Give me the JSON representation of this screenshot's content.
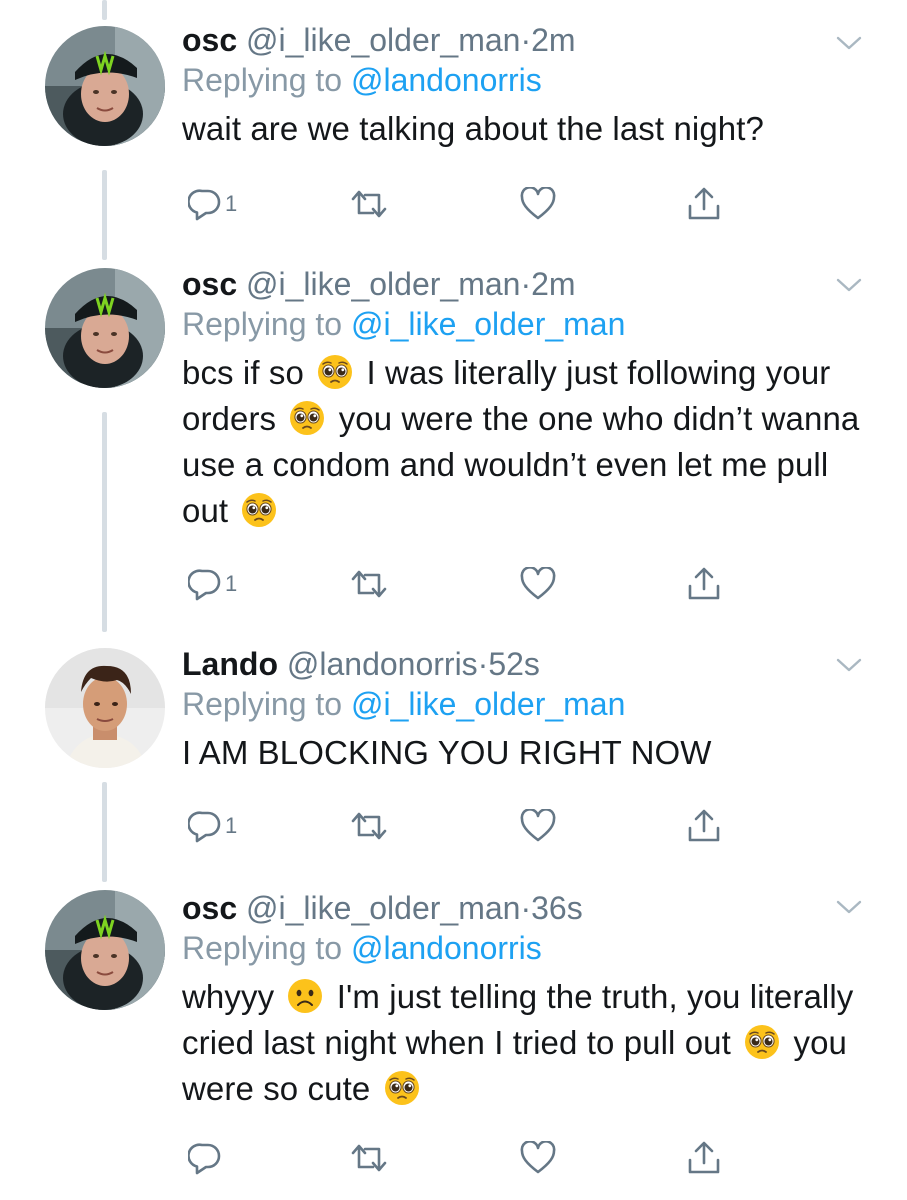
{
  "tweets": [
    {
      "name": "osc",
      "handle": "@i_like_older_man",
      "sep": "·",
      "time": "2m",
      "replying_prefix": "Replying to ",
      "replying_to": "@landonorris",
      "text_parts": [
        "wait are we talking about the last night?"
      ],
      "reply_count": "1",
      "avatar": "osc-avatar"
    },
    {
      "name": "osc",
      "handle": "@i_like_older_man",
      "sep": "·",
      "time": "2m",
      "replying_prefix": "Replying to ",
      "replying_to": "@i_like_older_man",
      "text_parts": [
        "bcs if so",
        "I was literally just following your orders",
        "you were the one who didn’t wanna use a condom and wouldn’t even let me pull out"
      ],
      "reply_count": "1",
      "avatar": "osc-avatar"
    },
    {
      "name": "Lando",
      "handle": "@landonorris",
      "sep": "·",
      "time": "52s",
      "replying_prefix": "Replying to ",
      "replying_to": "@i_like_older_man",
      "text_parts": [
        "I AM BLOCKING YOU RIGHT NOW"
      ],
      "reply_count": "1",
      "avatar": "lando-avatar"
    },
    {
      "name": "osc",
      "handle": "@i_like_older_man",
      "sep": "·",
      "time": "36s",
      "replying_prefix": "Replying to ",
      "replying_to": "@landonorris",
      "text_parts": [
        "whyyy",
        "I'm just telling the truth, you literally cried last night when I tried to pull out",
        "you were so cute"
      ],
      "reply_count": "",
      "avatar": "osc-avatar"
    }
  ],
  "icons": {
    "reply": "reply-icon",
    "retweet": "retweet-icon",
    "like": "heart-icon",
    "share": "share-icon",
    "more": "chevron-down-icon",
    "pleading": "pleading-face-emoji",
    "frown": "frowning-face-emoji"
  },
  "colors": {
    "name": "#14171a",
    "meta": "#657786",
    "mention": "#1da1f2",
    "thread_line": "#d6dde3",
    "emoji_yellow": "#fcc21b"
  }
}
